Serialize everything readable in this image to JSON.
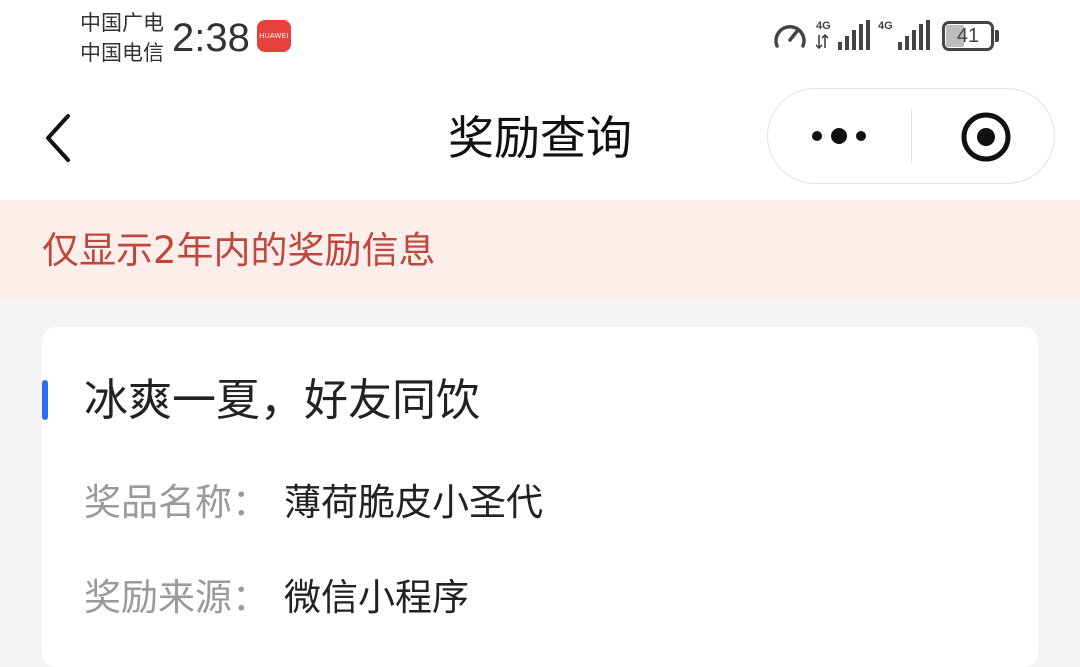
{
  "status_bar": {
    "carrier_1": "中国广电",
    "carrier_2": "中国电信",
    "time": "2:38",
    "appstore_icon_text": "HUAWEI",
    "signal_1_label": "4G",
    "signal_2_label": "4G",
    "battery_level": "41",
    "icons": [
      "speed-icon",
      "signal-icon",
      "signal-icon",
      "battery-icon"
    ]
  },
  "navbar": {
    "title": "奖励查询",
    "back_icon": "chevron-left-icon",
    "more_icon": "more-dots-icon",
    "close_icon": "target-close-icon"
  },
  "notice": {
    "text": "仅显示2年内的奖励信息"
  },
  "reward_card": {
    "title": "冰爽一夏，好友同饮",
    "fields": [
      {
        "label": "奖品名称：",
        "value": "薄荷脆皮小圣代"
      },
      {
        "label": "奖励来源：",
        "value": "微信小程序"
      }
    ]
  },
  "colors": {
    "accent_blue": "#2f6ef0",
    "notice_bg": "#fceeeb",
    "notice_text": "#c0473c",
    "page_bg": "#f4f4f4"
  }
}
